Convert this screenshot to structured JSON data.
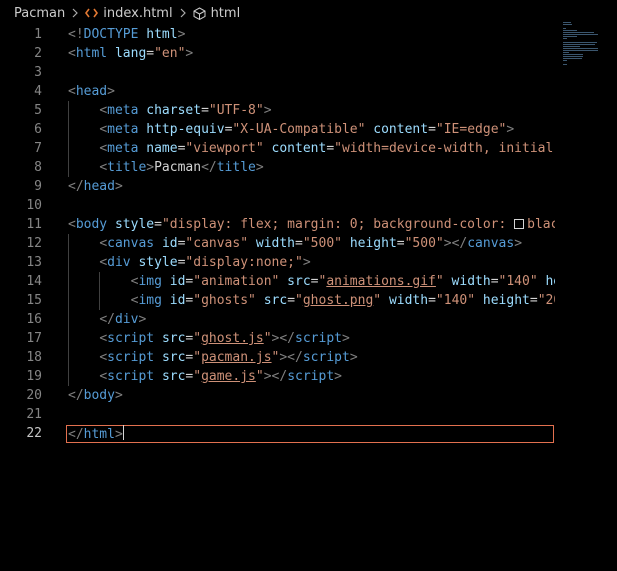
{
  "breadcrumb": {
    "folder": "Pacman",
    "file": "index.html",
    "symbol": "html"
  },
  "lines": [
    {
      "n": "1",
      "t": [
        [
          "pun",
          "<!"
        ],
        [
          "tag",
          "DOCTYPE"
        ],
        [
          "text",
          " "
        ],
        [
          "attr",
          "html"
        ],
        [
          "pun",
          ">"
        ]
      ]
    },
    {
      "n": "2",
      "t": [
        [
          "pun",
          "<"
        ],
        [
          "tag",
          "html"
        ],
        [
          "text",
          " "
        ],
        [
          "attr",
          "lang"
        ],
        [
          "text",
          "="
        ],
        [
          "str",
          "\"en\""
        ],
        [
          "pun",
          ">"
        ]
      ]
    },
    {
      "n": "3",
      "t": []
    },
    {
      "n": "4",
      "t": [
        [
          "pun",
          "<"
        ],
        [
          "tag",
          "head"
        ],
        [
          "pun",
          ">"
        ]
      ]
    },
    {
      "n": "5",
      "t": [
        [
          "text",
          "    "
        ],
        [
          "pun",
          "<"
        ],
        [
          "tag",
          "meta"
        ],
        [
          "text",
          " "
        ],
        [
          "attr",
          "charset"
        ],
        [
          "text",
          "="
        ],
        [
          "str",
          "\"UTF-8\""
        ],
        [
          "pun",
          ">"
        ]
      ]
    },
    {
      "n": "6",
      "t": [
        [
          "text",
          "    "
        ],
        [
          "pun",
          "<"
        ],
        [
          "tag",
          "meta"
        ],
        [
          "text",
          " "
        ],
        [
          "attr",
          "http-equiv"
        ],
        [
          "text",
          "="
        ],
        [
          "str",
          "\"X-UA-Compatible\""
        ],
        [
          "text",
          " "
        ],
        [
          "attr",
          "content"
        ],
        [
          "text",
          "="
        ],
        [
          "str",
          "\"IE=edge\""
        ],
        [
          "pun",
          ">"
        ]
      ]
    },
    {
      "n": "7",
      "t": [
        [
          "text",
          "    "
        ],
        [
          "pun",
          "<"
        ],
        [
          "tag",
          "meta"
        ],
        [
          "text",
          " "
        ],
        [
          "attr",
          "name"
        ],
        [
          "text",
          "="
        ],
        [
          "str",
          "\"viewport\""
        ],
        [
          "text",
          " "
        ],
        [
          "attr",
          "content"
        ],
        [
          "text",
          "="
        ],
        [
          "str",
          "\"width=device-width, initial-s"
        ]
      ]
    },
    {
      "n": "8",
      "t": [
        [
          "text",
          "    "
        ],
        [
          "pun",
          "<"
        ],
        [
          "tag",
          "title"
        ],
        [
          "pun",
          ">"
        ],
        [
          "text",
          "Pacman"
        ],
        [
          "pun",
          "</"
        ],
        [
          "tag",
          "title"
        ],
        [
          "pun",
          ">"
        ]
      ]
    },
    {
      "n": "9",
      "t": [
        [
          "pun",
          "</"
        ],
        [
          "tag",
          "head"
        ],
        [
          "pun",
          ">"
        ]
      ]
    },
    {
      "n": "10",
      "t": []
    },
    {
      "n": "11",
      "t": [
        [
          "pun",
          "<"
        ],
        [
          "tag",
          "body"
        ],
        [
          "text",
          " "
        ],
        [
          "attr",
          "style"
        ],
        [
          "text",
          "="
        ],
        [
          "str",
          "\"display: flex; margin: 0; background-color: "
        ],
        [
          "swatch",
          ""
        ],
        [
          "str",
          "blac"
        ]
      ]
    },
    {
      "n": "12",
      "t": [
        [
          "text",
          "    "
        ],
        [
          "pun",
          "<"
        ],
        [
          "tag",
          "canvas"
        ],
        [
          "text",
          " "
        ],
        [
          "attr",
          "id"
        ],
        [
          "text",
          "="
        ],
        [
          "str",
          "\"canvas\""
        ],
        [
          "text",
          " "
        ],
        [
          "attr",
          "width"
        ],
        [
          "text",
          "="
        ],
        [
          "str",
          "\"500\""
        ],
        [
          "text",
          " "
        ],
        [
          "attr",
          "height"
        ],
        [
          "text",
          "="
        ],
        [
          "str",
          "\"500\""
        ],
        [
          "pun",
          "></"
        ],
        [
          "tag",
          "canvas"
        ],
        [
          "pun",
          ">"
        ]
      ]
    },
    {
      "n": "13",
      "t": [
        [
          "text",
          "    "
        ],
        [
          "pun",
          "<"
        ],
        [
          "tag",
          "div"
        ],
        [
          "text",
          " "
        ],
        [
          "attr",
          "style"
        ],
        [
          "text",
          "="
        ],
        [
          "str",
          "\"display:none;\""
        ],
        [
          "pun",
          ">"
        ]
      ]
    },
    {
      "n": "14",
      "t": [
        [
          "text",
          "        "
        ],
        [
          "pun",
          "<"
        ],
        [
          "tag",
          "img"
        ],
        [
          "text",
          " "
        ],
        [
          "attr",
          "id"
        ],
        [
          "text",
          "="
        ],
        [
          "str",
          "\"animation\""
        ],
        [
          "text",
          " "
        ],
        [
          "attr",
          "src"
        ],
        [
          "text",
          "="
        ],
        [
          "str",
          "\""
        ],
        [
          "strlink",
          "animations.gif"
        ],
        [
          "str",
          "\""
        ],
        [
          "text",
          " "
        ],
        [
          "attr",
          "width"
        ],
        [
          "text",
          "="
        ],
        [
          "str",
          "\"140\""
        ],
        [
          "text",
          " "
        ],
        [
          "attr",
          "hei"
        ]
      ]
    },
    {
      "n": "15",
      "t": [
        [
          "text",
          "        "
        ],
        [
          "pun",
          "<"
        ],
        [
          "tag",
          "img"
        ],
        [
          "text",
          " "
        ],
        [
          "attr",
          "id"
        ],
        [
          "text",
          "="
        ],
        [
          "str",
          "\"ghosts\""
        ],
        [
          "text",
          " "
        ],
        [
          "attr",
          "src"
        ],
        [
          "text",
          "="
        ],
        [
          "str",
          "\""
        ],
        [
          "strlink",
          "ghost.png"
        ],
        [
          "str",
          "\""
        ],
        [
          "text",
          " "
        ],
        [
          "attr",
          "width"
        ],
        [
          "text",
          "="
        ],
        [
          "str",
          "\"140\""
        ],
        [
          "text",
          " "
        ],
        [
          "attr",
          "height"
        ],
        [
          "text",
          "="
        ],
        [
          "str",
          "\"20"
        ]
      ]
    },
    {
      "n": "16",
      "t": [
        [
          "text",
          "    "
        ],
        [
          "pun",
          "</"
        ],
        [
          "tag",
          "div"
        ],
        [
          "pun",
          ">"
        ]
      ]
    },
    {
      "n": "17",
      "t": [
        [
          "text",
          "    "
        ],
        [
          "pun",
          "<"
        ],
        [
          "tag",
          "script"
        ],
        [
          "text",
          " "
        ],
        [
          "attr",
          "src"
        ],
        [
          "text",
          "="
        ],
        [
          "str",
          "\""
        ],
        [
          "strlink",
          "ghost.js"
        ],
        [
          "str",
          "\""
        ],
        [
          "pun",
          "></"
        ],
        [
          "tag",
          "script"
        ],
        [
          "pun",
          ">"
        ]
      ]
    },
    {
      "n": "18",
      "t": [
        [
          "text",
          "    "
        ],
        [
          "pun",
          "<"
        ],
        [
          "tag",
          "script"
        ],
        [
          "text",
          " "
        ],
        [
          "attr",
          "src"
        ],
        [
          "text",
          "="
        ],
        [
          "str",
          "\""
        ],
        [
          "strlink",
          "pacman.js"
        ],
        [
          "str",
          "\""
        ],
        [
          "pun",
          "></"
        ],
        [
          "tag",
          "script"
        ],
        [
          "pun",
          ">"
        ]
      ]
    },
    {
      "n": "19",
      "t": [
        [
          "text",
          "    "
        ],
        [
          "pun",
          "<"
        ],
        [
          "tag",
          "script"
        ],
        [
          "text",
          " "
        ],
        [
          "attr",
          "src"
        ],
        [
          "text",
          "="
        ],
        [
          "str",
          "\""
        ],
        [
          "strlink",
          "game.js"
        ],
        [
          "str",
          "\""
        ],
        [
          "pun",
          "></"
        ],
        [
          "tag",
          "script"
        ],
        [
          "pun",
          ">"
        ]
      ]
    },
    {
      "n": "20",
      "t": [
        [
          "pun",
          "</"
        ],
        [
          "tag",
          "body"
        ],
        [
          "pun",
          ">"
        ]
      ]
    },
    {
      "n": "21",
      "t": []
    },
    {
      "n": "22",
      "t": [
        [
          "pun",
          "</"
        ],
        [
          "tag",
          "html"
        ],
        [
          "pun",
          ">"
        ],
        [
          "caret",
          ""
        ]
      ],
      "current": true
    }
  ]
}
